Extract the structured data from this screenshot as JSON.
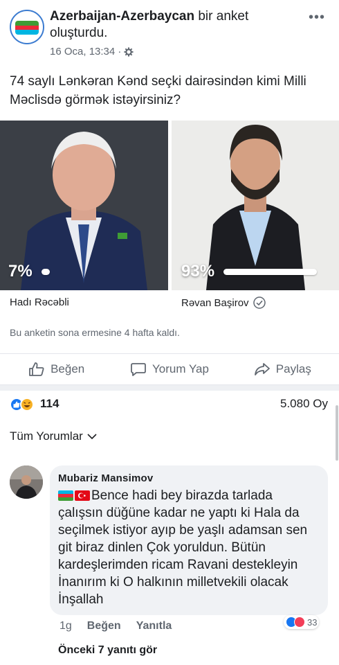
{
  "post": {
    "page_name": "Azerbaijan-Azerbaycan",
    "action_text": " bir anket oluşturdu.",
    "timestamp": "16 Oca, 13:34 ·",
    "question": "74 saylı Lənkəran Kənd seçki dairəsindən kimi Milli Məclisdə görmək istəyirsiniz?"
  },
  "poll": {
    "options": [
      {
        "name": "Hadı Rəcəbli",
        "percent_label": "7%",
        "percent": 7
      },
      {
        "name": "Rəvan Başirov",
        "percent_label": "93%",
        "percent": 93,
        "selected": true
      }
    ],
    "ends_text": "Bu anketin sona ermesine 4 hafta kaldı."
  },
  "actions": {
    "like": "Beğen",
    "comment": "Yorum Yap",
    "share": "Paylaş"
  },
  "stats": {
    "reaction_count": "114",
    "votes": "5.080 Oy"
  },
  "comments_sort": "Tüm Yorumlar",
  "comment": {
    "author": "Mubariz Mansimov",
    "text": "Bence hadi bey birazda tarlada çalışsın düğüne kadar ne yaptı ki Hala da seçilmek istiyor ayıp be yaşlı adamsan sen git biraz dinlen Çok yoruldun. Bütün kardeşlerimden ricam Ravani destekleyin İnanırım ki O halkının milletvekili olacak İnşallah",
    "age": "1g",
    "like": "Beğen",
    "reply": "Yanıtla",
    "reaction_count": "33"
  },
  "previous_replies": "Önceki 7 yanıtı gör",
  "colors": {
    "accent": "#1877f2",
    "muted": "#606770",
    "bubble": "#f0f2f5"
  }
}
